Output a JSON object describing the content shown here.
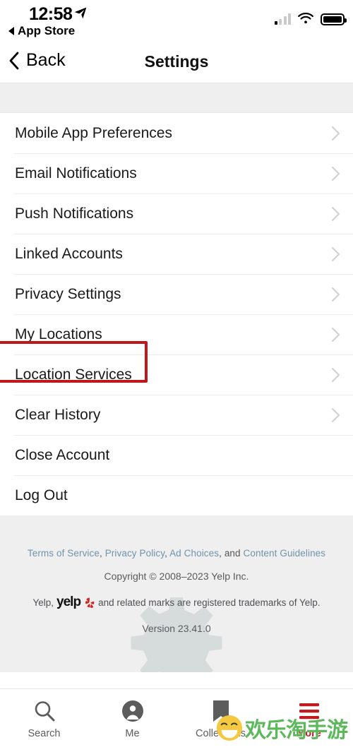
{
  "status_bar": {
    "time": "12:58",
    "back_app_label": "App Store",
    "location_arrow_icon": "location-arrow-icon",
    "signal_icon": "cellular-signal-icon",
    "wifi_icon": "wifi-icon",
    "battery_icon": "battery-full-icon"
  },
  "nav": {
    "back_label": "Back",
    "back_icon": "chevron-left-icon",
    "title": "Settings"
  },
  "settings": {
    "rows": [
      {
        "label": "Mobile App Preferences",
        "chevron": true,
        "highlighted": false
      },
      {
        "label": "Email Notifications",
        "chevron": true,
        "highlighted": false
      },
      {
        "label": "Push Notifications",
        "chevron": true,
        "highlighted": false
      },
      {
        "label": "Linked Accounts",
        "chevron": true,
        "highlighted": false
      },
      {
        "label": "Privacy Settings",
        "chevron": true,
        "highlighted": false
      },
      {
        "label": "My Locations",
        "chevron": true,
        "highlighted": false
      },
      {
        "label": "Location Services",
        "chevron": true,
        "highlighted": true
      },
      {
        "label": "Clear History",
        "chevron": true,
        "highlighted": false
      },
      {
        "label": "Close Account",
        "chevron": false,
        "highlighted": false
      },
      {
        "label": "Log Out",
        "chevron": false,
        "highlighted": false
      }
    ]
  },
  "footer": {
    "links": [
      {
        "text": "Terms of Service"
      },
      {
        "text": "Privacy Policy"
      },
      {
        "text": "Ad Choices"
      },
      {
        "text": "Content Guidelines"
      }
    ],
    "links_sep": ", ",
    "links_and": ", and ",
    "copyright": "Copyright © 2008–2023 Yelp Inc.",
    "trademark_prefix": "Yelp,",
    "trademark_wordmark": "yelp",
    "trademark_suffix": "and related marks are registered trademarks of Yelp.",
    "version": "Version 23.41.0",
    "gear_watermark_icon": "gear-icon"
  },
  "tabbar": {
    "tabs": [
      {
        "label": "Search",
        "icon": "search-icon",
        "active": false
      },
      {
        "label": "Me",
        "icon": "person-circle-icon",
        "active": false
      },
      {
        "label": "Collections",
        "icon": "bookmark-icon",
        "active": false
      },
      {
        "label": "More",
        "icon": "hamburger-menu-icon",
        "active": true
      }
    ]
  },
  "watermark": {
    "text": "欢乐淘手游",
    "face_icon": "smiley-face-icon"
  },
  "colors": {
    "accent_red": "#bf1b20",
    "highlight_box": "#c0171c",
    "link_blue": "#6f93ab",
    "panel_gray": "#efefef",
    "divider": "#ececec",
    "watermark_green": "#5db85c"
  }
}
